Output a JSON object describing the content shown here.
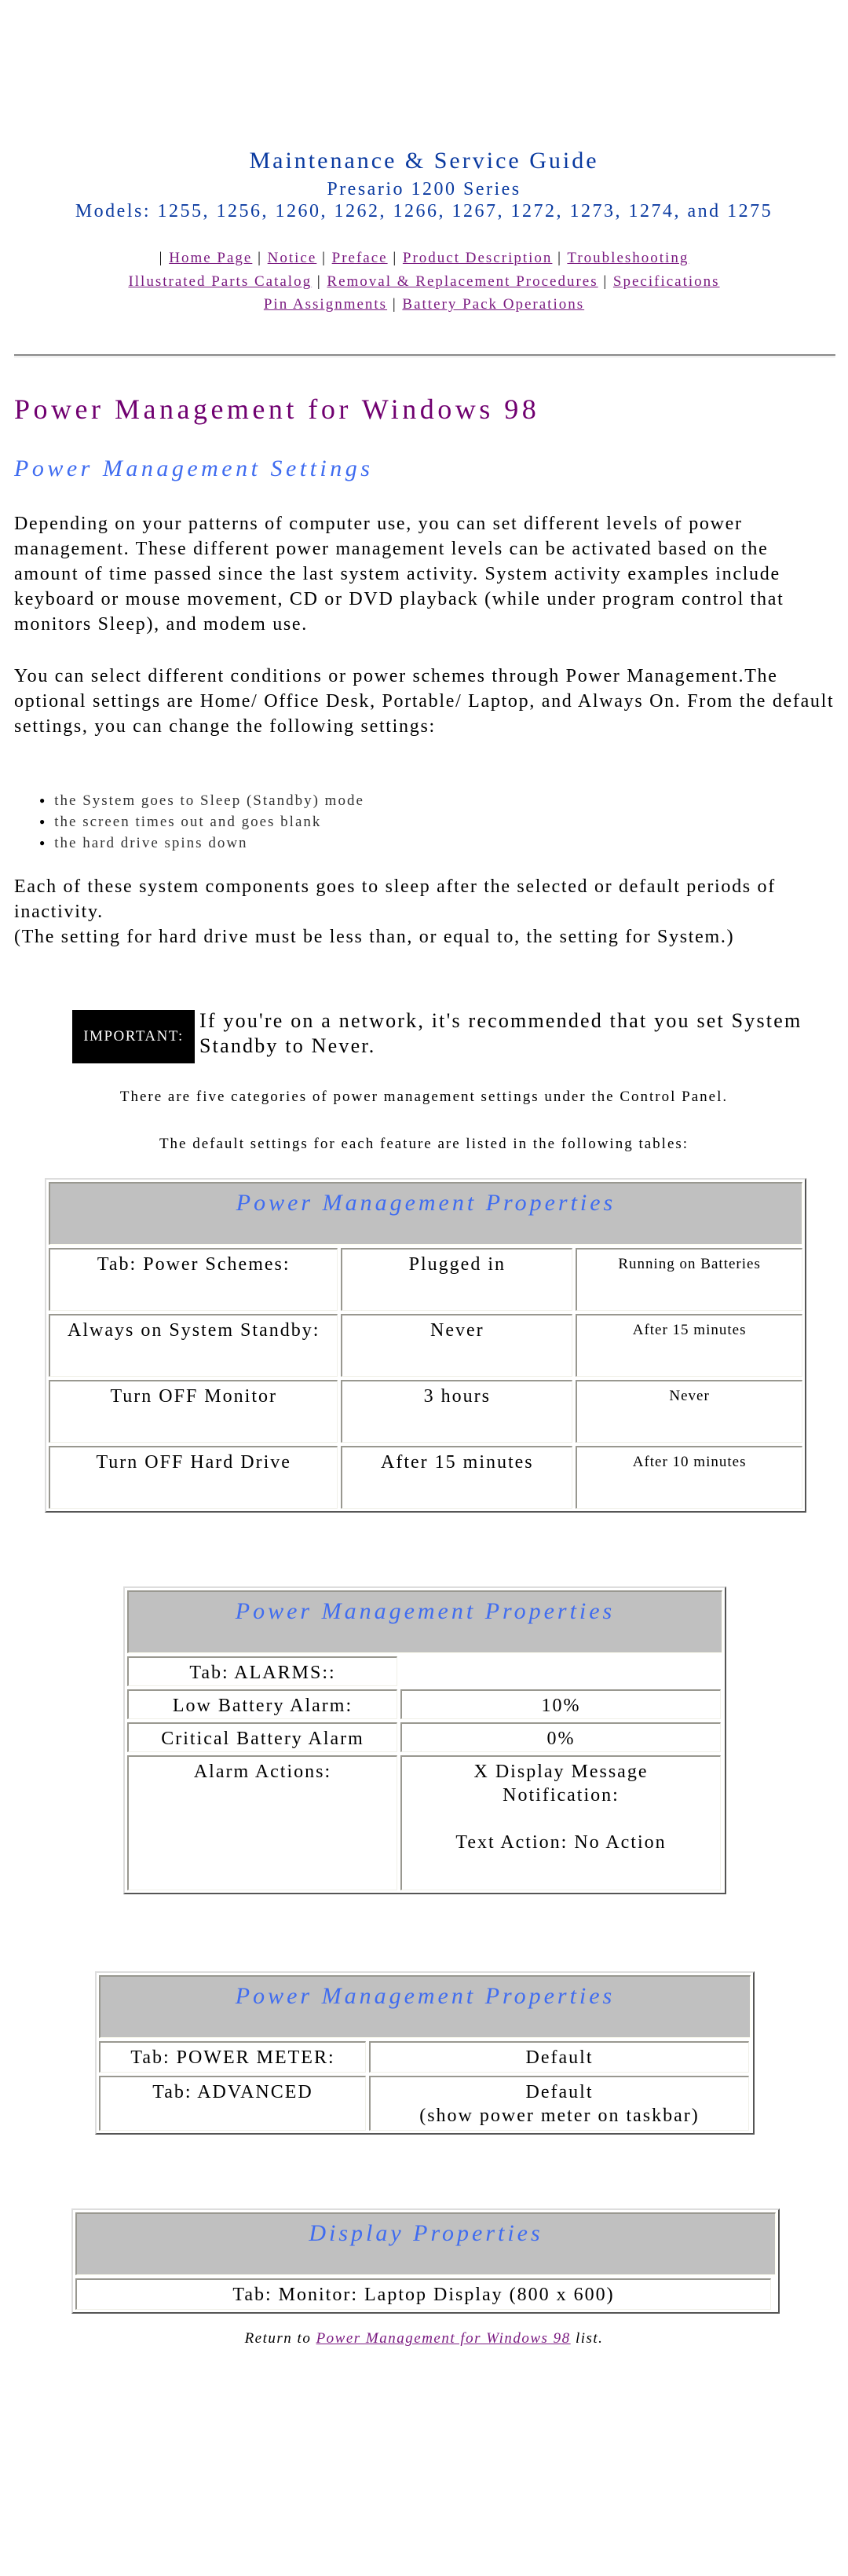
{
  "header": {
    "title": "Maintenance & Service Guide",
    "series": "Presario 1200 Series",
    "models": "Models: 1255, 1256, 1260, 1262, 1266, 1267, 1272, 1273, 1274, and 1275"
  },
  "nav": {
    "separator": "|",
    "links": [
      "Home Page",
      "Notice",
      "Preface",
      "Product Description",
      "Troubleshooting",
      "Illustrated Parts Catalog",
      "Removal & Replacement Procedures",
      "Specifications",
      "Pin Assignments",
      "Battery Pack Operations"
    ]
  },
  "page": {
    "title": "Power Management for Windows 98",
    "section_title": "Power Management Settings",
    "paragraph1": "Depending on your patterns of computer use, you can set different levels of power management. These different power management levels can be activated based on the amount of time passed since the last system activity. System activity examples include keyboard or mouse movement, CD or DVD playback (while under program control that monitors Sleep), and modem use.",
    "paragraph2": "You can select different conditions or power schemes through Power Management.The optional settings are Home/ Office Desk, Portable/ Laptop, and Always On. From the default settings, you can change the following settings:",
    "bullets": [
      "the System goes to Sleep (Standby) mode",
      "the screen times out and goes blank",
      "the hard drive spins down"
    ],
    "paragraph3a": "Each of these system components goes to sleep after the selected or default periods of inactivity.",
    "paragraph3b": "(The setting for hard drive must be less than, or equal to, the setting for System.)",
    "important_label": "IMPORTANT:",
    "important_text": "If you're on a network, it's recommended that you set System Standby to Never.",
    "note1": "There are five categories of power management settings under the Control Panel.",
    "note2": "The default settings for each feature are listed in the following tables:"
  },
  "tables": {
    "power_schemes": {
      "caption": "Power Management Properties",
      "header": [
        "Tab: Power Schemes:",
        "Plugged in",
        "Running on Batteries"
      ],
      "rows": [
        [
          "Always on System Standby:",
          "Never",
          "After 15 minutes"
        ],
        [
          "Turn OFF Monitor",
          "3 hours",
          "Never"
        ],
        [
          "Turn OFF Hard Drive",
          "After 15 minutes",
          "After 10 minutes"
        ]
      ]
    },
    "alarms": {
      "caption": "Power Management Properties",
      "tab_label": "Tab: ALARMS::",
      "rows": [
        [
          "Low Battery Alarm:",
          "10%"
        ],
        [
          "Critical Battery Alarm",
          "0%"
        ]
      ],
      "actions_label": "Alarm Actions:",
      "actions_value_1": "X Display Message Notification:",
      "actions_value_2": "Text Action: No Action"
    },
    "power_meter": {
      "caption": "Power Management Properties",
      "rows": [
        [
          "Tab: POWER METER:",
          "Default"
        ],
        [
          "Tab: ADVANCED",
          "Default"
        ]
      ],
      "advanced_note": "(show power meter on taskbar)"
    },
    "display": {
      "caption": "Display Properties",
      "row": "Tab: Monitor: Laptop Display (800 x 600)"
    }
  },
  "footer": {
    "return_prefix": "Return to ",
    "return_link": "Power Management for Windows 98",
    "return_suffix": " list."
  },
  "colors": {
    "header_blue": "#0a3aa0",
    "link_purple": "#7a1a80",
    "title_purple": "#700070",
    "accent_blue": "#3f6cf0",
    "caption_gray": "#c0c0c0"
  }
}
